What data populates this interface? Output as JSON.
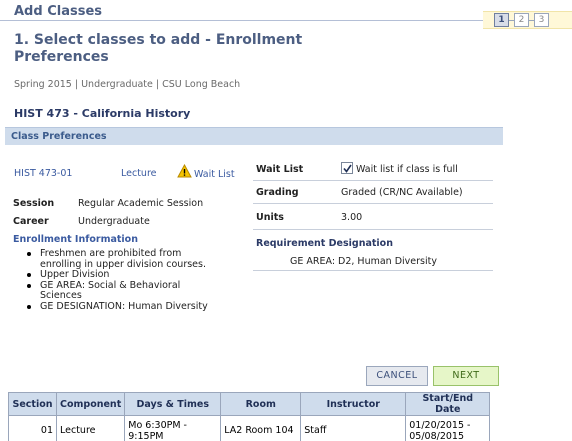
{
  "page": {
    "header": "Add Classes",
    "step_title": "1.  Select classes to add - Enrollment Preferences",
    "term_info": "Spring 2015 | Undergraduate | CSU Long Beach",
    "course_title": "HIST  473 - California History"
  },
  "steps": [
    "1",
    "2",
    "3"
  ],
  "section": {
    "title": "Class Preferences"
  },
  "class": {
    "number": "HIST 473-01",
    "component": "Lecture",
    "wait_list_link": "Wait List",
    "session_label": "Session",
    "session_value": "Regular Academic Session",
    "career_label": "Career",
    "career_value": "Undergraduate",
    "enrollment_heading": "Enrollment Information",
    "enrollment_items": [
      "Freshmen are prohibited from enrolling in upper division courses.",
      "Upper Division",
      "GE AREA: Social & Behavioral Sciences",
      "GE DESIGNATION: Human Diversity"
    ]
  },
  "prefs": {
    "waitlist_label": "Wait List",
    "waitlist_checkbox_label": "Wait list if class is full",
    "waitlist_checked": true,
    "grading_label": "Grading",
    "grading_value": "Graded (CR/NC Available)",
    "units_label": "Units",
    "units_value": "3.00",
    "requirement_heading": "Requirement Designation",
    "requirement_value": "GE AREA: D2, Human Diversity"
  },
  "buttons": {
    "cancel": "CANCEL",
    "next": "NEXT"
  },
  "table": {
    "headers": [
      "Section",
      "Component",
      "Days & Times",
      "Room",
      "Instructor",
      "Start/End Date"
    ],
    "rows": [
      [
        "01",
        "Lecture",
        "Mo 6:30PM - 9:15PM",
        "LA2  Room 104",
        "Staff",
        "01/20/2015 - 05/08/2015"
      ]
    ]
  },
  "icons": {
    "wait_list": "warning-triangle-icon",
    "checkbox": "checkmark-icon"
  },
  "colors": {
    "heading": "#4c5e82",
    "link": "#3a5aa0",
    "section_bar": "#cfdcec",
    "next_button": "#e6f6c8"
  }
}
